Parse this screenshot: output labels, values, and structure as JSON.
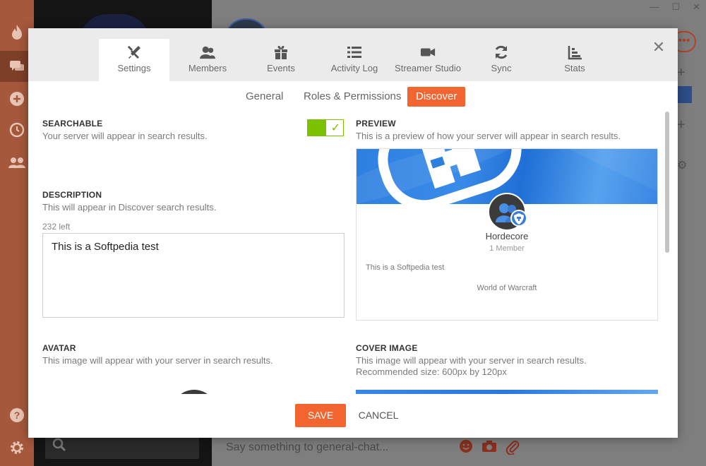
{
  "app": {
    "chat_placeholder": "Say something to general-chat...",
    "accent_color": "#f26530",
    "rail_color": "#a5583b",
    "rail_icons": [
      "flame-icon",
      "chat-icon",
      "plus-icon",
      "history-icon",
      "group-icon",
      "help-icon",
      "gear-icon"
    ]
  },
  "modal": {
    "tabs": [
      {
        "label": "Settings",
        "icon": "tools-icon"
      },
      {
        "label": "Members",
        "icon": "members-icon"
      },
      {
        "label": "Events",
        "icon": "gift-icon"
      },
      {
        "label": "Activity Log",
        "icon": "list-icon"
      },
      {
        "label": "Streamer Studio",
        "icon": "camera-icon"
      },
      {
        "label": "Sync",
        "icon": "sync-icon"
      },
      {
        "label": "Stats",
        "icon": "stats-icon"
      }
    ],
    "active_tab": "Settings",
    "subtabs": [
      "General",
      "Roles & Permissions",
      "Discover"
    ],
    "active_subtab": "Discover",
    "close_glyph": "✕"
  },
  "searchable": {
    "title": "SEARCHABLE",
    "desc": "Your server will appear in search results.",
    "enabled": true
  },
  "description": {
    "title": "DESCRIPTION",
    "desc": "This will appear in Discover search results.",
    "chars_left": "232 left",
    "value": "This is a Softpedia test"
  },
  "preview": {
    "title": "PREVIEW",
    "desc": "This is a preview of how your server will appear in search results.",
    "server_name": "Hordecore",
    "members": "1 Member",
    "description": "This is a Softpedia test",
    "game": "World of Warcraft"
  },
  "avatar": {
    "title": "AVATAR",
    "desc": "This image will appear with your server in search results."
  },
  "cover_image": {
    "title": "COVER IMAGE",
    "desc": "This image will appear with your server in search results.",
    "recommended": "Recommended size: 600px by 120px"
  },
  "actions": {
    "save": "SAVE",
    "cancel": "CANCEL"
  }
}
